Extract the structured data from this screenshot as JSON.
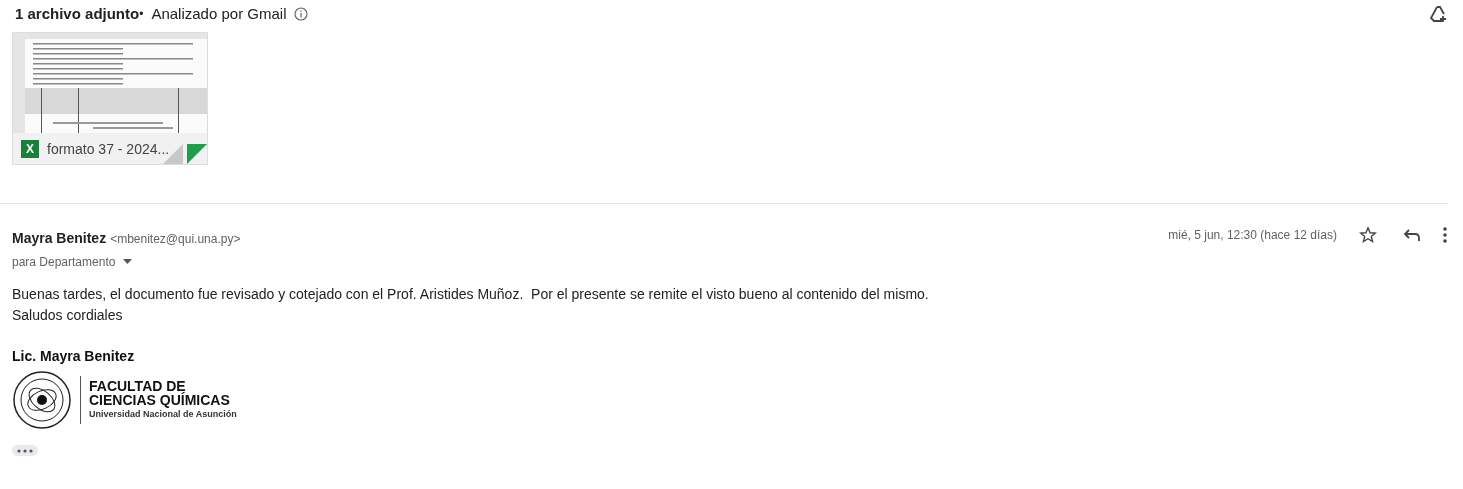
{
  "attachments_header": {
    "count_label": "1 archivo adjunto",
    "separator": "•",
    "scan_label": "Analizado por Gmail"
  },
  "attachments": [
    {
      "kind": "picture",
      "type_letter": "X",
      "file_name": "formato 37 - 2024..."
    }
  ],
  "message": {
    "sender_name": "Mayra Benitez",
    "sender_email": "<mbenitez@qui.una.py>",
    "recipients": "para Departamento",
    "date": "mié, 5 jun, 12:30 (hace 12 días)",
    "starred": false,
    "body": [
      "Buenas tardes, el documento fue revisado y cotejado con el Prof. Aristides Muñoz.  Por el presente se remite el visto bueno al contenido del mismo.",
      "Saludos cordiales"
    ],
    "signature": {
      "name": "Lic. Mayra Benitez",
      "logo_lines": [
        "FACULTAD DE",
        "CIENCIAS QUÍMICAS",
        "Universidad Nacional de Asunción"
      ]
    }
  }
}
